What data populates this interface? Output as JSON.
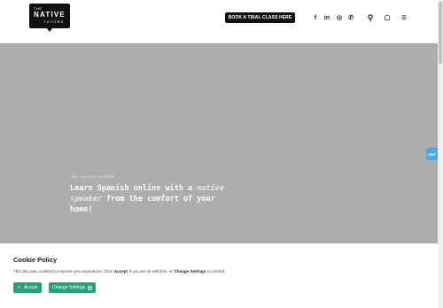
{
  "header": {
    "logo": {
      "line1": "THE",
      "line2": "NATIVE",
      "line3": "TUTORS"
    },
    "cta_label": "BOOK A TRIAL CLASS HERE",
    "icons": [
      "facebook-icon",
      "linkedin-icon",
      "instagram-icon",
      "whatsapp-icon",
      "search-icon",
      "cart-icon",
      "menu-icon"
    ],
    "icon_glyphs": {
      "facebook": "f",
      "linkedin": "in",
      "instagram": "◎",
      "whatsapp": "✆",
      "search": "⚲",
      "cart": "▢",
      "menu": "≡"
    }
  },
  "hero": {
    "eyebrow": "THE NATIVE TUTORS",
    "headline_part1": "Learn Spanish online with a ",
    "headline_em": "native speaker",
    "headline_part2": " from the comfort of your home!",
    "background": "#adadad"
  },
  "side_tab": {
    "label": "GBP"
  },
  "cookie": {
    "title": "Cookie Policy",
    "text_part1": "This site uses cookies to improve your experience. Click '",
    "accept_ref": "Accept",
    "text_part2": "' if you are ok with this, or '",
    "settings_ref": "Change Settings",
    "text_part3": "' to amend.",
    "accept_label": "Accept",
    "settings_label": "Change Settings",
    "accent": "#2aa07a"
  }
}
